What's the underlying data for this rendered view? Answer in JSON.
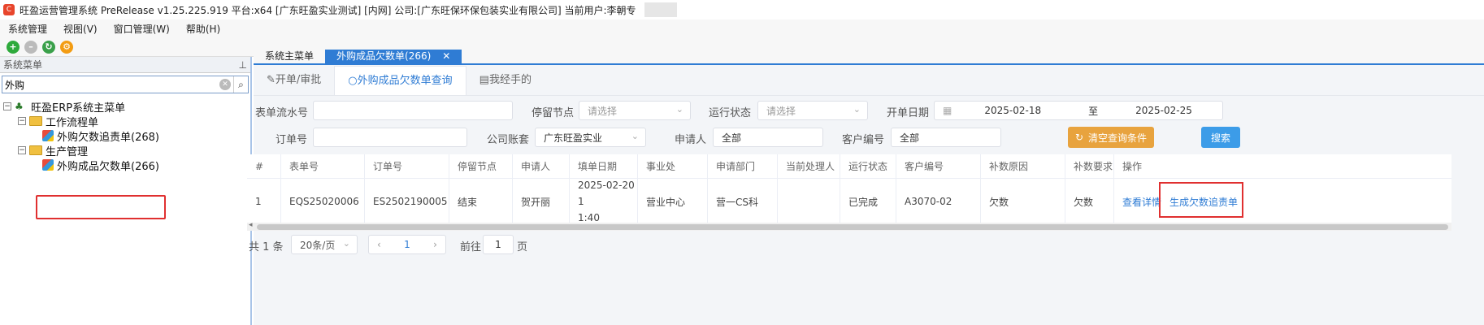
{
  "window": {
    "title": "旺盈运营管理系统 PreRelease v1.25.225.919 平台:x64  [广东旺盈实业测试] [内网] 公司:[广东旺保环保包装实业有限公司] 当前用户:李朝专"
  },
  "menubar": {
    "items": [
      "系统管理",
      "视图(V)",
      "窗口管理(W)",
      "帮助(H)"
    ]
  },
  "sidebar": {
    "header": "系统菜单",
    "pin": "ᵖ",
    "search_value": "外购",
    "tree": {
      "root": "旺盈ERP系统主菜单",
      "group1": "工作流程单",
      "item1": "外购欠数追责单(268)",
      "group2": "生产管理",
      "item2": "外购成品欠数单(266)"
    }
  },
  "doc_tabs": {
    "main": "系统主菜单",
    "active": "外购成品欠数单(266)",
    "close": "✕"
  },
  "sub_tabs": [
    "开单/审批",
    "外购成品欠数单查询",
    "我经手的"
  ],
  "filters": {
    "serial_label": "表单流水号",
    "stop_node_label": "停留节点",
    "stop_node_placeholder": "请选择",
    "run_status_label": "运行状态",
    "run_status_placeholder": "请选择",
    "date_label": "开单日期",
    "date_from": "2025-02-18",
    "date_to_sep": "至",
    "date_to": "2025-02-25",
    "order_label": "订单号",
    "company_label": "公司账套",
    "company_value": "广东旺盈实业",
    "applicant_label": "申请人",
    "applicant_value": "全部",
    "customer_label": "客户编号",
    "customer_value": "全部",
    "clear_button": "清空查询条件",
    "search_button": "搜索"
  },
  "table": {
    "headers": [
      "#",
      "表单号",
      "订单号",
      "停留节点",
      "申请人",
      "填单日期",
      "事业处",
      "申请部门",
      "当前处理人",
      "运行状态",
      "客户编号",
      "补数原因",
      "补数要求",
      "操作"
    ],
    "rows": [
      {
        "idx": "1",
        "form_no": "EQS25020006",
        "order_no": "ES2502190005",
        "stop_node": "结束",
        "applicant": "贺开丽",
        "date_line1": "2025-02-20 1",
        "date_line2": "1:40",
        "division": "营业中心",
        "dept": "营一CS科",
        "handler": "",
        "status": "已完成",
        "customer": "A3070-02",
        "reason": "欠数",
        "requirement": "欠数",
        "op_view": "查看详情",
        "op_generate": "生成欠数追责单"
      }
    ]
  },
  "pager": {
    "total": "共 1 条",
    "page_size": "20条/页",
    "prev": "‹",
    "current": "1",
    "next": "›",
    "goto_label": "前往",
    "goto_value": "1",
    "page_unit": "页"
  }
}
